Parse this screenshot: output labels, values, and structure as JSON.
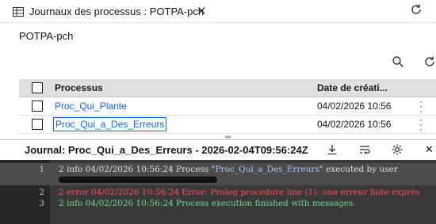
{
  "tab": {
    "title": "Journaux des processus : POTPA-pch",
    "close_glyph": "✕"
  },
  "subtitle": "POTPA-pch",
  "grid": {
    "columns": [
      "Processus",
      "Date de créati..."
    ],
    "rows": [
      {
        "name": "Proc_Qui_Plante",
        "date": "04/02/2026 10:56"
      },
      {
        "name": "Proc_Qui_a_Des_Erreurs",
        "date": "04/02/2026 10:56"
      }
    ]
  },
  "log": {
    "title": "Journal: Proc_Qui_a_Des_Erreurs - 2026-02-04T09:56:24Z",
    "lines": [
      {
        "num": "1",
        "pre": "2  info  04/02/2026 10:56:24  Process \"",
        "proc": "Proc_Qui_a_Des_Erreurs",
        "post": "\" executed by user"
      },
      {
        "num": "2",
        "text": "2  error  04/02/2026 10:56:24  Error: Prolog procedure line (1): une erreur faite exprès"
      },
      {
        "num": "3",
        "text": "2  info  04/02/2026 10:56:24  Process execution finished with messages."
      }
    ]
  },
  "colors": {
    "accent": "#0f62fe",
    "log_bg": "#393939",
    "info": "#6fdc8c",
    "error": "#fa4d56"
  },
  "icons": [
    "table-icon",
    "close-icon",
    "refresh-icon",
    "search-icon",
    "download-icon",
    "wrap-icon",
    "settings-icon",
    "kebab-icon"
  ]
}
